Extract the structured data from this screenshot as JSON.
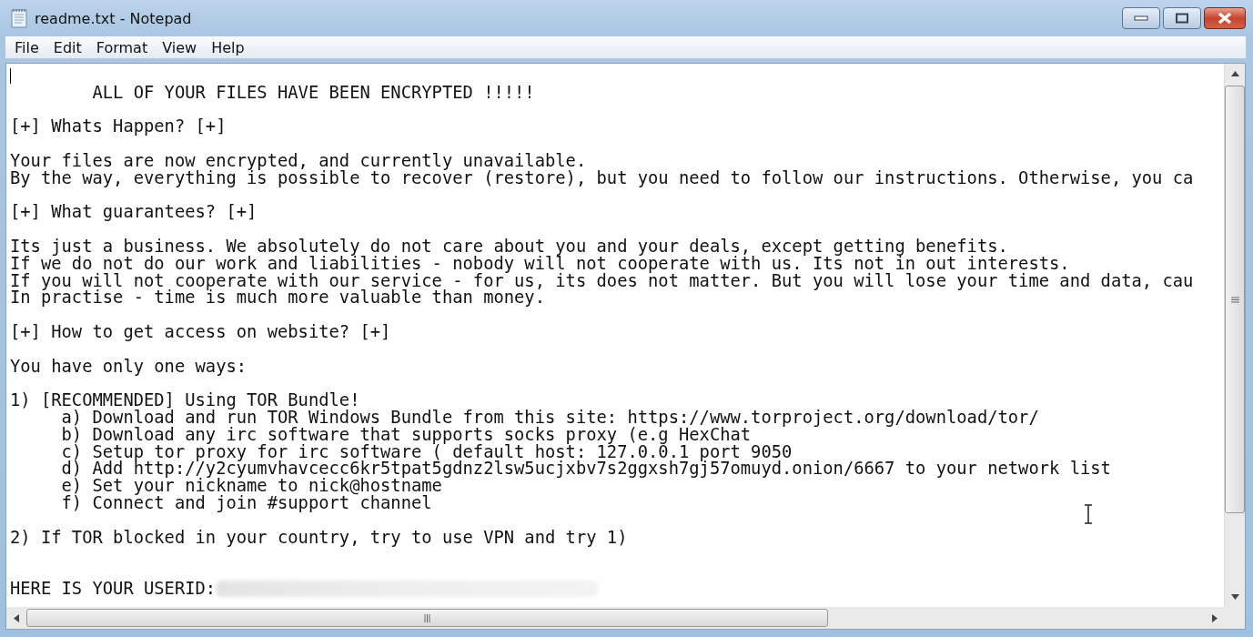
{
  "window": {
    "title": "readme.txt - Notepad"
  },
  "menu": [
    "File",
    "Edit",
    "Format",
    "View",
    "Help"
  ],
  "document": {
    "blocks": [
      {
        "kind": "cursor",
        "lines": [
          "        ALL OF YOUR FILES HAVE BEEN ENCRYPTED !!!!!"
        ]
      },
      {
        "kind": "text",
        "lines": [
          "[+] Whats Happen? [+]"
        ]
      },
      {
        "kind": "text",
        "lines": [
          "Your files are now encrypted, and currently unavailable.",
          "By the way, everything is possible to recover (restore), but you need to follow our instructions. Otherwise, you ca"
        ]
      },
      {
        "kind": "text",
        "lines": [
          "[+] What guarantees? [+]"
        ]
      },
      {
        "kind": "text",
        "lines": [
          "Its just a business. We absolutely do not care about you and your deals, except getting benefits.",
          "If we do not do our work and liabilities - nobody will not cooperate with us. Its not in out interests.",
          "If you will not cooperate with our service - for us, its does not matter. But you will lose your time and data, cau",
          "In practise - time is much more valuable than money."
        ]
      },
      {
        "kind": "text",
        "lines": [
          "[+] How to get access on website? [+]"
        ]
      },
      {
        "kind": "text",
        "lines": [
          "You have only one ways:"
        ]
      },
      {
        "kind": "text",
        "lines": [
          "1) [RECOMMENDED] Using TOR Bundle!",
          "     a) Download and run TOR Windows Bundle from this site: https://www.torproject.org/download/tor/",
          "     b) Download any irc software that supports socks proxy (e.g HexChat",
          "     c) Setup tor proxy for irc software ( default host: 127.0.0.1 port 9050",
          "     d) Add http://y2cyumvhavcecc6kr5tpat5gdnz2lsw5ucjxbv7s2ggxsh7gj57omuyd.onion/6667 to your network list",
          "     e) Set your nickname to nick@hostname",
          "     f) Connect and join #support channel"
        ]
      },
      {
        "kind": "text",
        "lines": [
          "2) If TOR blocked in your country, try to use VPN and try 1)"
        ]
      },
      {
        "kind": "redacted",
        "lines": [
          "HERE IS YOUR USERID:"
        ]
      }
    ]
  }
}
